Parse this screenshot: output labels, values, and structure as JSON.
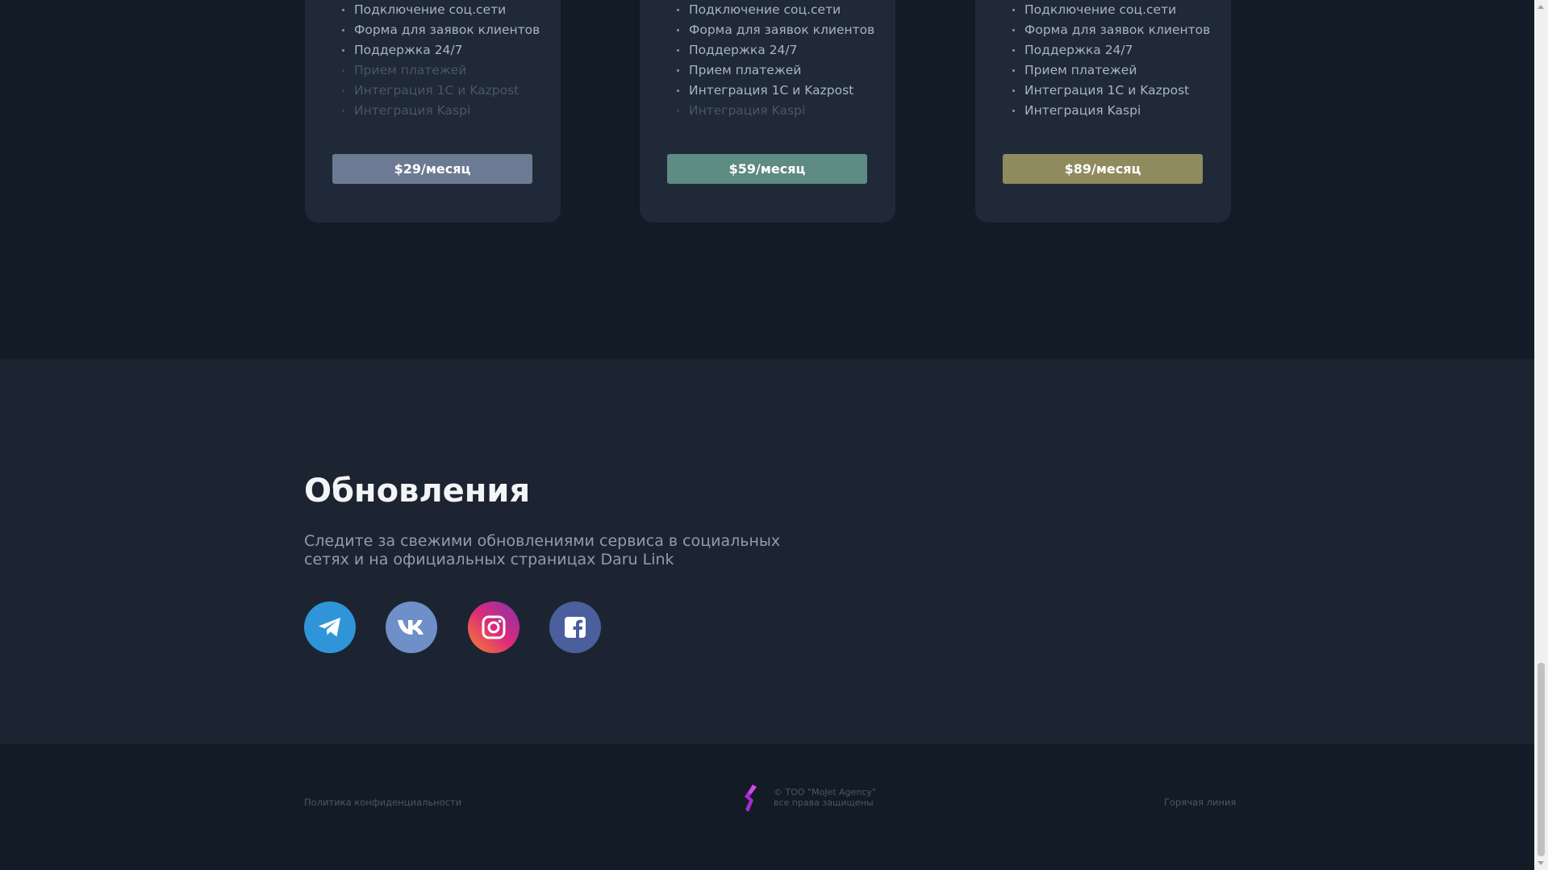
{
  "pricing": {
    "plans": [
      {
        "features": [
          {
            "label": "Подключение соц.сети",
            "enabled": true
          },
          {
            "label": "Форма для заявок клиентов",
            "enabled": true
          },
          {
            "label": "Поддержка 24/7",
            "enabled": true
          },
          {
            "label": "Прием платежей",
            "enabled": false
          },
          {
            "label": "Интеграция 1С и Kazpost",
            "enabled": false
          },
          {
            "label": "Интеграция Kaspi",
            "enabled": false
          }
        ],
        "price_label": "$29/месяц",
        "button_color": "#6d7a93"
      },
      {
        "features": [
          {
            "label": "Подключение соц.сети",
            "enabled": true
          },
          {
            "label": "Форма для заявок клиентов",
            "enabled": true
          },
          {
            "label": "Поддержка 24/7",
            "enabled": true
          },
          {
            "label": "Прием платежей",
            "enabled": true
          },
          {
            "label": "Интеграция 1С и Kazpost",
            "enabled": true
          },
          {
            "label": "Интеграция Kaspi",
            "enabled": false
          }
        ],
        "price_label": "$59/месяц",
        "button_color": "#5e8b82"
      },
      {
        "features": [
          {
            "label": "Подключение соц.сети",
            "enabled": true
          },
          {
            "label": "Форма для заявок клиентов",
            "enabled": true
          },
          {
            "label": "Поддержка 24/7",
            "enabled": true
          },
          {
            "label": "Прием платежей",
            "enabled": true
          },
          {
            "label": "Интеграция 1С и Kazpost",
            "enabled": true
          },
          {
            "label": "Интеграция Kaspi",
            "enabled": true
          }
        ],
        "price_label": "$89/месяц",
        "button_color": "#8f8b5e"
      }
    ]
  },
  "updates": {
    "title": "Обновления",
    "description": "Следите за свежими обновлениями сервиса в социальных сетях и на официальных страницах Daru Link",
    "socials": [
      {
        "icon": "telegram-icon",
        "color": "#2f95d8"
      },
      {
        "icon": "vk-icon",
        "color": "#6f8fc9"
      },
      {
        "icon": "instagram-icon",
        "color": "#e1306c"
      },
      {
        "icon": "facebook-icon",
        "color": "#4a5f9c"
      }
    ]
  },
  "footer": {
    "privacy_link": "Политика конфиденциальности",
    "copyright_line1": "© ТОО \"MoJet Agency\"",
    "copyright_line2": "все права защищены",
    "hotline_link": "Горячая линия",
    "logo_icon": "mojet-logo-icon",
    "logo_color": "#a72bd6"
  }
}
